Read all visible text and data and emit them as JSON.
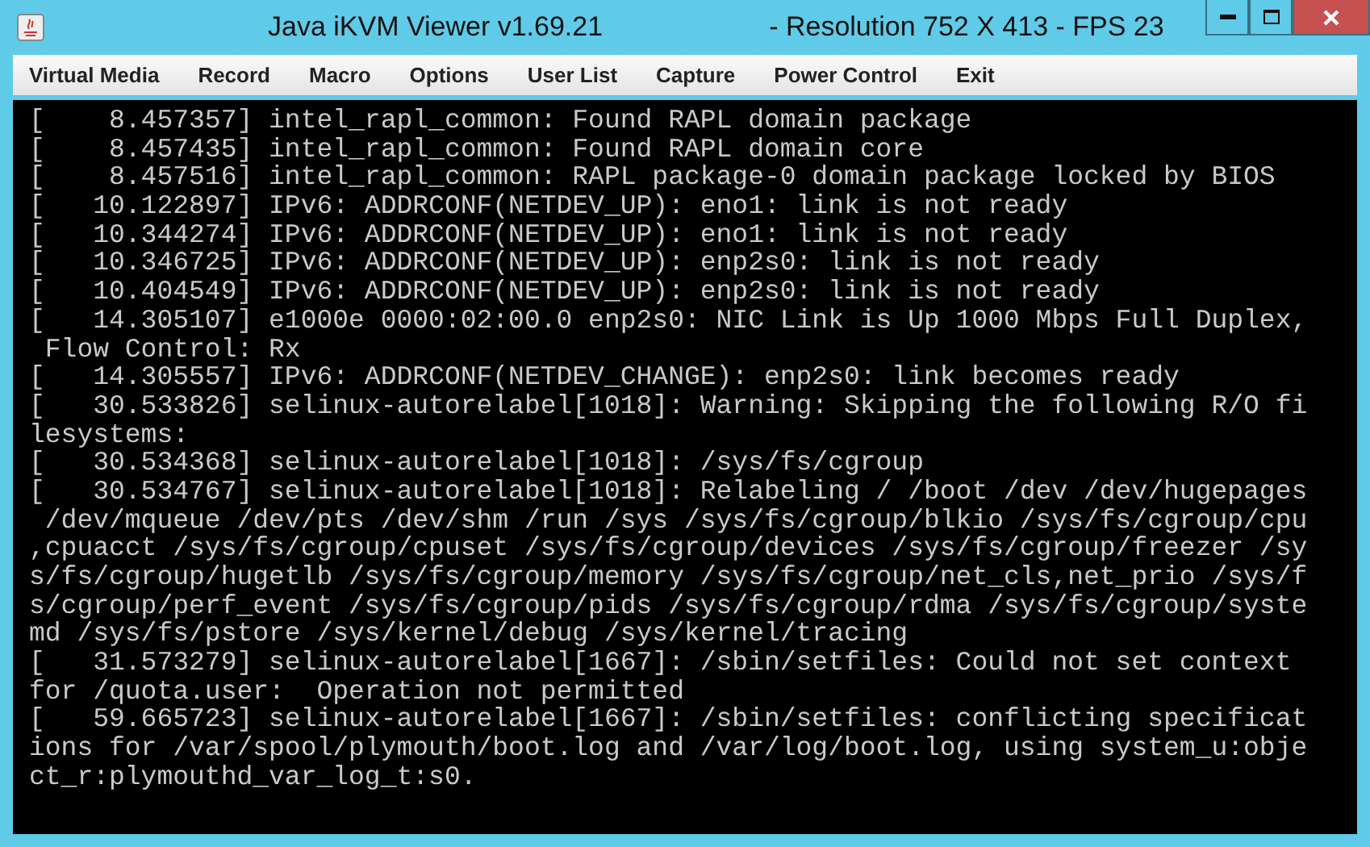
{
  "window": {
    "title": "Java iKVM Viewer v1.69.21",
    "subtitle": "- Resolution 752 X 413 - FPS 23"
  },
  "menu": [
    "Virtual Media",
    "Record",
    "Macro",
    "Options",
    "User List",
    "Capture",
    "Power Control",
    "Exit"
  ],
  "console": {
    "lines": [
      "[    8.457357] intel_rapl_common: Found RAPL domain package",
      "[    8.457435] intel_rapl_common: Found RAPL domain core",
      "[    8.457516] intel_rapl_common: RAPL package-0 domain package locked by BIOS",
      "[   10.122897] IPv6: ADDRCONF(NETDEV_UP): eno1: link is not ready",
      "[   10.344274] IPv6: ADDRCONF(NETDEV_UP): eno1: link is not ready",
      "[   10.346725] IPv6: ADDRCONF(NETDEV_UP): enp2s0: link is not ready",
      "[   10.404549] IPv6: ADDRCONF(NETDEV_UP): enp2s0: link is not ready",
      "[   14.305107] e1000e 0000:02:00.0 enp2s0: NIC Link is Up 1000 Mbps Full Duplex,",
      " Flow Control: Rx",
      "[   14.305557] IPv6: ADDRCONF(NETDEV_CHANGE): enp2s0: link becomes ready",
      "[   30.533826] selinux-autorelabel[1018]: Warning: Skipping the following R/O fi",
      "lesystems:",
      "[   30.534368] selinux-autorelabel[1018]: /sys/fs/cgroup",
      "[   30.534767] selinux-autorelabel[1018]: Relabeling / /boot /dev /dev/hugepages",
      " /dev/mqueue /dev/pts /dev/shm /run /sys /sys/fs/cgroup/blkio /sys/fs/cgroup/cpu",
      ",cpuacct /sys/fs/cgroup/cpuset /sys/fs/cgroup/devices /sys/fs/cgroup/freezer /sy",
      "s/fs/cgroup/hugetlb /sys/fs/cgroup/memory /sys/fs/cgroup/net_cls,net_prio /sys/f",
      "s/cgroup/perf_event /sys/fs/cgroup/pids /sys/fs/cgroup/rdma /sys/fs/cgroup/syste",
      "md /sys/fs/pstore /sys/kernel/debug /sys/kernel/tracing",
      "[   31.573279] selinux-autorelabel[1667]: /sbin/setfiles: Could not set context",
      "for /quota.user:  Operation not permitted",
      "[   59.665723] selinux-autorelabel[1667]: /sbin/setfiles: conflicting specificat",
      "ions for /var/spool/plymouth/boot.log and /var/log/boot.log, using system_u:obje",
      "ct_r:plymouthd_var_log_t:s0."
    ]
  }
}
